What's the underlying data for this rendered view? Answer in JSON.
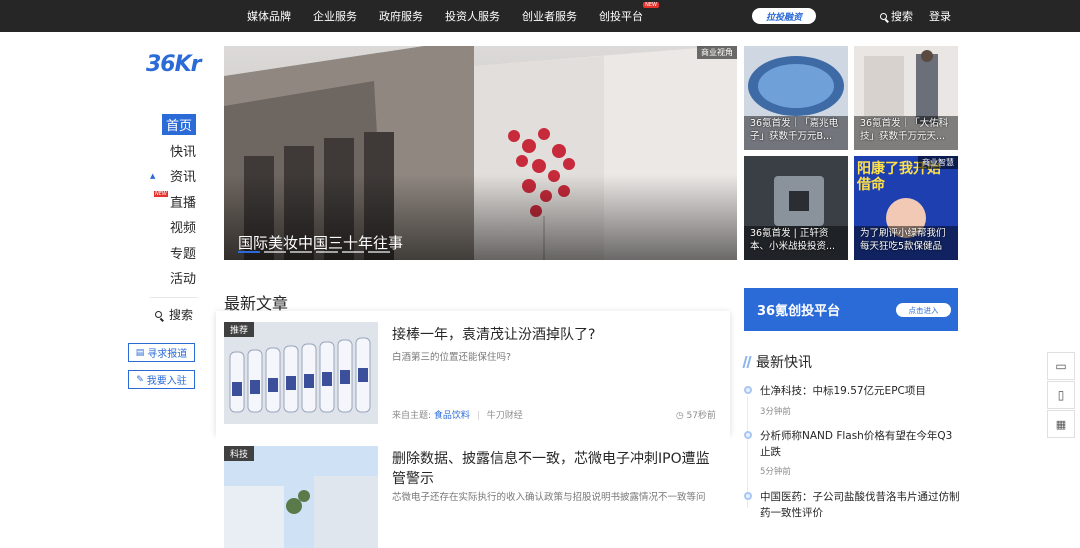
{
  "topnav": {
    "items": [
      "媒体品牌",
      "企业服务",
      "政府服务",
      "投资人服务",
      "创业者服务",
      "创投平台"
    ],
    "badge": "拉投融资",
    "search": "搜索",
    "login": "登录"
  },
  "logo": "36Kr",
  "sidebar": {
    "items": [
      "首页",
      "快讯",
      "资讯",
      "直播",
      "视频",
      "专题",
      "活动"
    ],
    "search": "搜索",
    "btn_report": "寻求报道",
    "btn_join": "我要入驻"
  },
  "hero": {
    "label": "商业视角",
    "title": "国际美妆中国三十年往事"
  },
  "thumbs": [
    {
      "caption": "36氪首发｜「嘉兆电子」获数千万元B..."
    },
    {
      "caption": "36氪首发｜「大佑科技」获数千万元天..."
    },
    {
      "caption": "36氪首发 | 正轩资本、小米战投投资..."
    },
    {
      "caption": "为了刷评小绿帮我们每天狂吃5款保健品",
      "label": "商业智慧",
      "overlay": "阳康了我开始借命"
    }
  ],
  "section_title": "最新文章",
  "articles": [
    {
      "tag": "推荐",
      "title": "接棒一年，袁清茂让汾酒掉队了?",
      "summary": "白酒第三的位置还能保住吗?",
      "from": "来自主题:",
      "topic": "食品饮料",
      "author": "牛刀财经",
      "time": "57秒前"
    },
    {
      "tag": "科技",
      "title": "删除数据、披露信息不一致，芯微电子冲刺IPO遭监管警示",
      "summary": "芯微电子还存在实际执行的收入确认政策与招股说明书披露情况不一致等问"
    }
  ],
  "promo": {
    "title": "36氪创投平台",
    "button": "点击进入"
  },
  "flash": {
    "title": "最新快讯",
    "items": [
      {
        "text": "仕净科技：中标19.57亿元EPC项目",
        "time": "3分钟前"
      },
      {
        "text": "分析师称NAND Flash价格有望在今年Q3止跌",
        "time": "5分钟前"
      },
      {
        "text": "中国医药：子公司盐酸伐昔洛韦片通过仿制药一致性评价",
        "time": ""
      }
    ]
  }
}
